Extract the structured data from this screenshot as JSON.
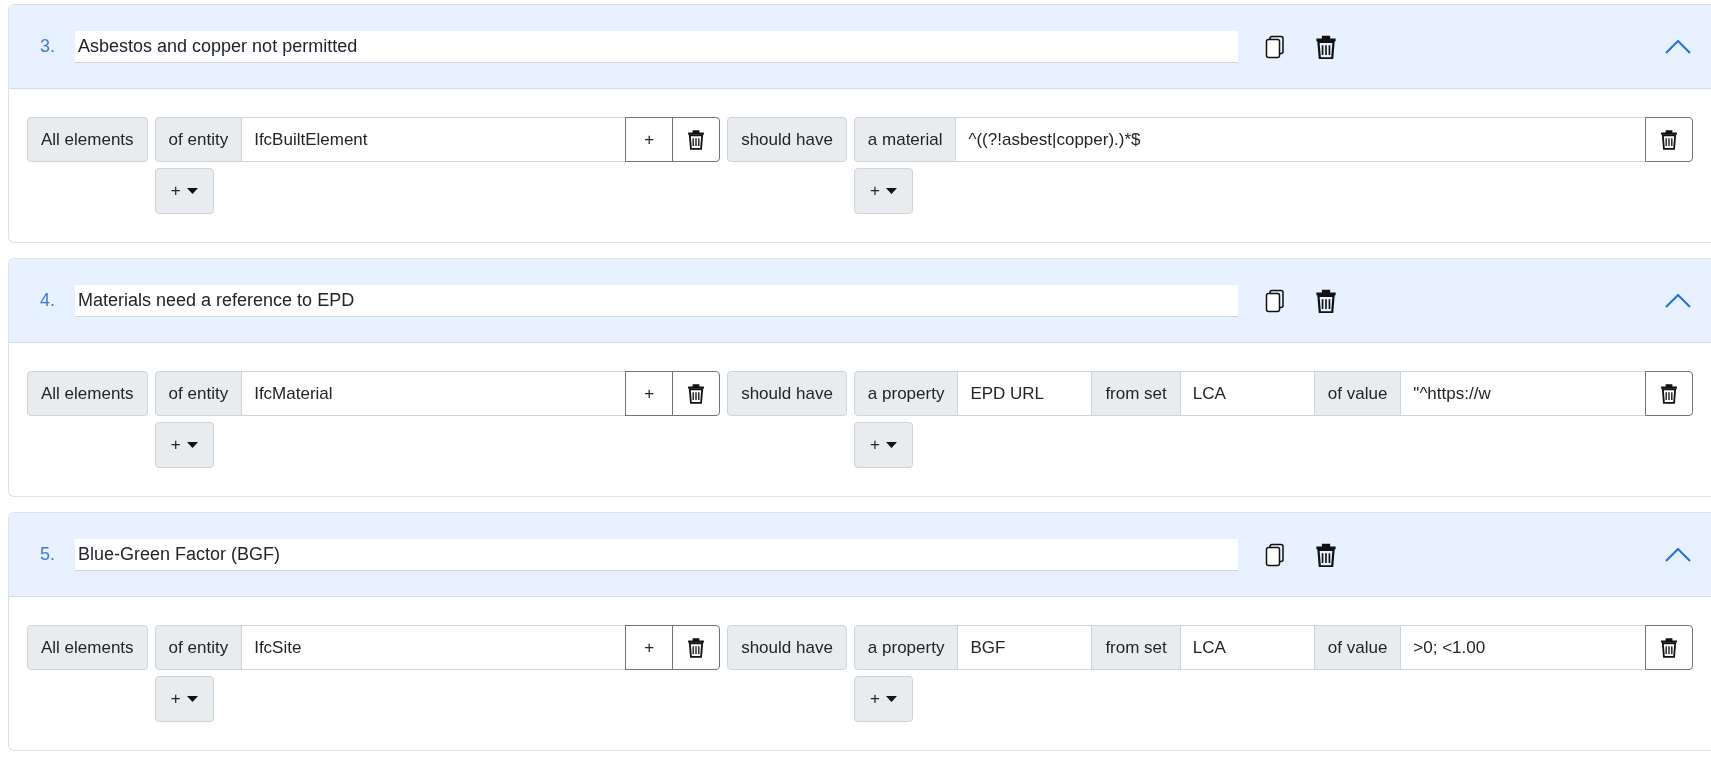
{
  "rules": [
    {
      "number": "3.",
      "title": "Asbestos and copper not permitted",
      "expanded": true,
      "applicability": {
        "label": "All elements",
        "facets": [
          {
            "label": "of entity",
            "value": "IfcBuiltElement",
            "add": "+"
          }
        ],
        "add": "+"
      },
      "requirement": {
        "label": "should have",
        "facets": [
          {
            "parts": [
              {
                "kind": "label",
                "text": "a material"
              },
              {
                "kind": "value",
                "text": "^((?!asbest|copper).)*$"
              }
            ]
          }
        ],
        "add": "+"
      }
    },
    {
      "number": "4.",
      "title": "Materials need a reference to EPD",
      "expanded": true,
      "applicability": {
        "label": "All elements",
        "facets": [
          {
            "label": "of entity",
            "value": "IfcMaterial",
            "add": "+"
          }
        ],
        "add": "+"
      },
      "requirement": {
        "label": "should have",
        "facets": [
          {
            "parts": [
              {
                "kind": "label",
                "text": "a property"
              },
              {
                "kind": "value",
                "text": "EPD URL"
              },
              {
                "kind": "label",
                "text": "from set"
              },
              {
                "kind": "value",
                "text": "LCA"
              },
              {
                "kind": "label",
                "text": "of value"
              },
              {
                "kind": "value",
                "text": "\"^https://w"
              }
            ]
          }
        ],
        "add": "+"
      }
    },
    {
      "number": "5.",
      "title": "Blue-Green Factor (BGF)",
      "expanded": true,
      "applicability": {
        "label": "All elements",
        "facets": [
          {
            "label": "of entity",
            "value": "IfcSite",
            "add": "+"
          }
        ],
        "add": "+"
      },
      "requirement": {
        "label": "should have",
        "facets": [
          {
            "parts": [
              {
                "kind": "label",
                "text": "a property"
              },
              {
                "kind": "value",
                "text": "BGF"
              },
              {
                "kind": "label",
                "text": "from set"
              },
              {
                "kind": "value",
                "text": "LCA"
              },
              {
                "kind": "label",
                "text": "of value"
              },
              {
                "kind": "value",
                "text": ">0; <1.00"
              }
            ]
          }
        ],
        "add": "+"
      }
    }
  ]
}
